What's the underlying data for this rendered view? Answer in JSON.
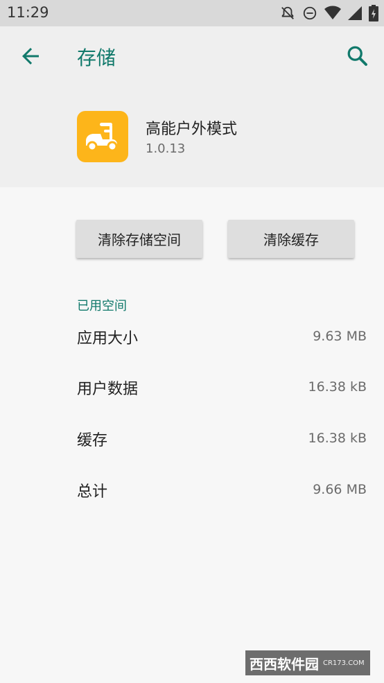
{
  "status_bar": {
    "time": "11:29"
  },
  "header": {
    "title": "存储"
  },
  "app": {
    "name": "高能户外模式",
    "version": "1.0.13"
  },
  "actions": {
    "clear_storage": "清除存储空间",
    "clear_cache": "清除缓存"
  },
  "usage": {
    "section_label": "已用空间",
    "rows": [
      {
        "label": "应用大小",
        "value": "9.63 MB"
      },
      {
        "label": "用户数据",
        "value": "16.38 kB"
      },
      {
        "label": "缓存",
        "value": "16.38 kB"
      },
      {
        "label": "总计",
        "value": "9.66 MB"
      }
    ]
  },
  "watermark": {
    "text": "西西软件园",
    "sub": "CR173.COM"
  },
  "colors": {
    "accent": "#11796b",
    "app_icon_bg": "#fdb51a",
    "header_bg": "#efefef",
    "status_bar_bg": "#d9d9d9"
  }
}
